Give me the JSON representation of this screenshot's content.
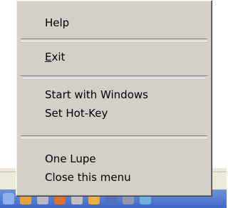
{
  "menu": {
    "items": [
      {
        "label": "Help"
      },
      {
        "label_underlined": "E",
        "label_rest": "xit"
      },
      {
        "label": "Start with Windows"
      },
      {
        "label": "Set Hot-Key"
      },
      {
        "label": "One Lupe"
      },
      {
        "label": "Close this menu"
      }
    ]
  },
  "colors": {
    "menu_bg": "#d4d0c8",
    "taskbar": "#3d68c7"
  }
}
